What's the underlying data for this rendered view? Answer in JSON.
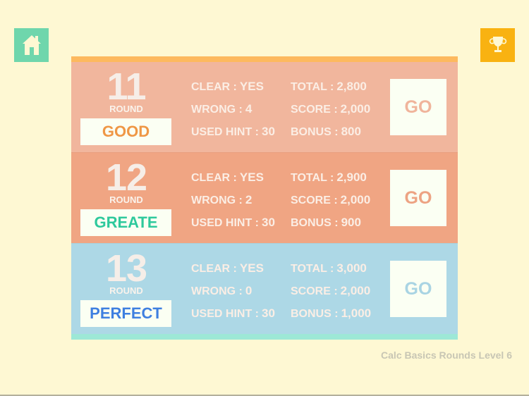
{
  "header": {
    "home_icon": "home-icon",
    "trophy_icon": "trophy-icon"
  },
  "colors": {
    "background": "#fef8d3",
    "home_button": "#6fd6ac",
    "trophy_button": "#f9b211",
    "panel_top_strip": "#fdb95e",
    "panel_bottom_strip": "#9de8d6"
  },
  "rounds": [
    {
      "number": "11",
      "round_label": "ROUND",
      "grade": "GOOD",
      "grade_color": "#ef9745",
      "bg_color": "#f1b69d",
      "go_color": "#f0b49b",
      "clear_label": "CLEAR :",
      "clear_value": "YES",
      "wrong_label": "WRONG :",
      "wrong_value": "4",
      "hint_label": "USED HINT :",
      "hint_value": "30",
      "total_label": "TOTAL :",
      "total_value": "2,800",
      "score_label": "SCORE :",
      "score_value": "2,000",
      "bonus_label": "BONUS :",
      "bonus_value": "800",
      "go_label": "GO"
    },
    {
      "number": "12",
      "round_label": "ROUND",
      "grade": "GREATE",
      "grade_color": "#2ec99c",
      "bg_color": "#f0a583",
      "go_color": "#eda383",
      "clear_label": "CLEAR :",
      "clear_value": "YES",
      "wrong_label": "WRONG :",
      "wrong_value": "2",
      "hint_label": "USED HINT :",
      "hint_value": "30",
      "total_label": "TOTAL :",
      "total_value": "2,900",
      "score_label": "SCORE :",
      "score_value": "2,000",
      "bonus_label": "BONUS :",
      "bonus_value": "900",
      "go_label": "GO"
    },
    {
      "number": "13",
      "round_label": "ROUND",
      "grade": "PERFECT",
      "grade_color": "#3f7fe0",
      "bg_color": "#add8e6",
      "go_color": "#a9d4e3",
      "clear_label": "CLEAR :",
      "clear_value": "YES",
      "wrong_label": "WRONG :",
      "wrong_value": "0",
      "hint_label": "USED HINT :",
      "hint_value": "30",
      "total_label": "TOTAL :",
      "total_value": "3,000",
      "score_label": "SCORE :",
      "score_value": "2,000",
      "bonus_label": "BONUS :",
      "bonus_value": "1,000",
      "go_label": "GO"
    }
  ],
  "footer": {
    "level_text": "Calc Basics Rounds Level 6"
  }
}
